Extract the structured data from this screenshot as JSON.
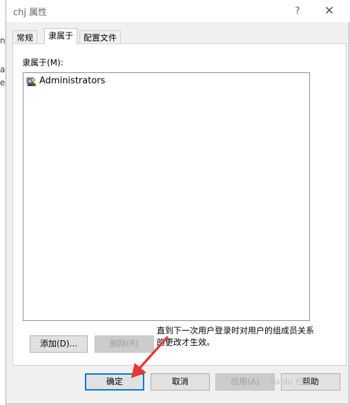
{
  "background_window": {
    "fragments": [
      "ni",
      "au",
      "es"
    ]
  },
  "dialog": {
    "title": "chj 属性",
    "help_glyph": "?",
    "close_glyph": "✕",
    "tabs": [
      {
        "label": "常规",
        "active": false
      },
      {
        "label": "隶属于",
        "active": true
      },
      {
        "label": "配置文件",
        "active": false
      }
    ],
    "member_of_label": "隶属于(M):",
    "groups": [
      {
        "name": "Administrators",
        "icon": "user-group-icon"
      }
    ],
    "add_button": "添加(D)...",
    "remove_button": "删除(R)",
    "note": "直到下一次用户登录时对用户的组成员关系的更改才生效。",
    "ok_button": "确定",
    "cancel_button": "取消",
    "apply_button": "应用(A)",
    "help_button": "帮助"
  },
  "annotation": {
    "arrow_color": "#e53935",
    "watermark": "Baidu 经验"
  }
}
